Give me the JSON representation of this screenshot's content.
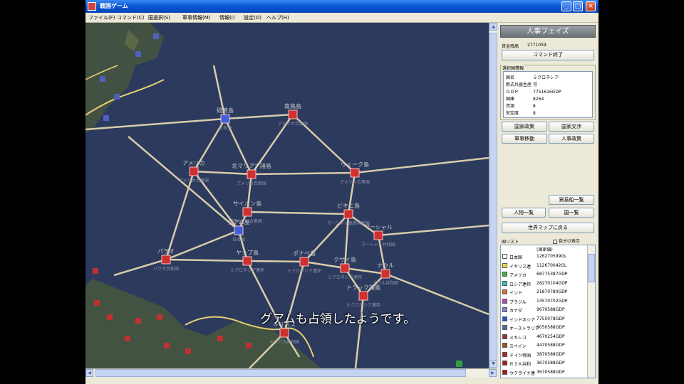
{
  "window": {
    "title": "戦国ゲーム"
  },
  "menu": [
    "ファイル(F)",
    "コマンド(C)",
    "国選択(S)",
    "軍事情報(M)",
    "情報(I)",
    "設定(O)",
    "ヘルプ(H)"
  ],
  "panel": {
    "phase": "人事フェイズ",
    "funds_label": "資金残高",
    "funds_value": "2771059",
    "end_command": "コマンド終了",
    "selected_country_label": "選択国情報",
    "info": [
      {
        "k": "国名",
        "v": "ミクロネシア"
      },
      {
        "k": "新式兵器生産",
        "v": "可"
      },
      {
        "k": "ＧＤＰ",
        "v": "7751616GDP"
      },
      {
        "k": "国庫",
        "v": "8264"
      },
      {
        "k": "資源",
        "v": "8"
      },
      {
        "k": "安定度",
        "v": "8"
      }
    ],
    "action_buttons": [
      "国家政策",
      "国家交渉",
      "軍事移動",
      "人事政策"
    ],
    "trade_list": "貿易船一覧",
    "person_list": "人物一覧",
    "country_button": "国一覧",
    "world_map_back": "世界マップに戻る",
    "country_list_label": "国リスト",
    "color_display": "色分け表示",
    "list_header": "(国家値)",
    "countries": [
      {
        "name": "日本国",
        "gdp": "126270599GL",
        "color": "#ffffff"
      },
      {
        "name": "イギリス連",
        "gdp": "112670042GL",
        "color": "#f0e040"
      },
      {
        "name": "アメリカ",
        "gdp": "68775387GDP",
        "color": "#30c030"
      },
      {
        "name": "ロシア連邦",
        "gdp": "28270104GDP",
        "color": "#30c0c0"
      },
      {
        "name": "インド",
        "gdp": "21870780GDP",
        "color": "#e07020"
      },
      {
        "name": "ブラジル",
        "gdp": "13570702GDP",
        "color": "#c040c0"
      },
      {
        "name": "カナダ",
        "gdp": "9670588GDP",
        "color": "#9080e0"
      },
      {
        "name": "インドネシア",
        "gdp": "7755078GDP",
        "color": "#3050d0"
      },
      {
        "name": "オーストラリア",
        "gdp": "6050588GDP",
        "color": "#507090"
      },
      {
        "name": "メキシコ",
        "gdp": "4670254GDP",
        "color": "#a03030"
      },
      {
        "name": "スペイン",
        "gdp": "4470588GDP",
        "color": "#a05010"
      },
      {
        "name": "ドイツ帝国",
        "gdp": "3870588GDP",
        "color": "#c02020"
      },
      {
        "name": "ＲＳＫ共和",
        "gdp": "3670588GDP",
        "color": "#b01818"
      },
      {
        "name": "ウクライナ連",
        "gdp": "3670588GDP",
        "color": "#c01010"
      }
    ]
  },
  "map": {
    "subtitle": "グアムも占領したようです。",
    "nodes": [
      {
        "name": "硫黄島",
        "sub": "日本領",
        "color": "#4060e0"
      },
      {
        "name": "南鳥島",
        "sub": "アメリカ合衆国",
        "color": "#d03030"
      },
      {
        "name": "アメリカ",
        "sub": "アメリカ合衆国",
        "color": "#d03030"
      },
      {
        "name": "北マリアナ諸島",
        "sub": "アメリカ合衆国",
        "color": "#d03030"
      },
      {
        "name": "ウェーク島",
        "sub": "アメリカ合衆国",
        "color": "#d03030"
      },
      {
        "name": "サイパン島",
        "sub": "アメリカ合衆国",
        "color": "#d03030"
      },
      {
        "name": "ビキニ島",
        "sub": "マーシャル諸島共和国",
        "color": "#d03030"
      },
      {
        "name": "グアム島",
        "sub": "日本国",
        "color": "#4060e0"
      },
      {
        "name": "マーシャル",
        "sub": "マーシャル共和国",
        "color": "#d03030"
      },
      {
        "name": "パラオ",
        "sub": "パラオ共和国",
        "color": "#d03030"
      },
      {
        "name": "ヤップ島",
        "sub": "ミクロネシア連邦",
        "color": "#d03030"
      },
      {
        "name": "ポナペ島",
        "sub": "ミクロネシア連邦",
        "color": "#d03030"
      },
      {
        "name": "クサイ島",
        "sub": "ミクロネシア連邦",
        "color": "#d03030"
      },
      {
        "name": "ナウル",
        "sub": "ナウル共和国",
        "color": "#d03030"
      },
      {
        "name": "トラック諸島",
        "sub": "ミクロネシア連邦",
        "color": "#d03030"
      },
      {
        "name": "キリバス",
        "sub": "キリバス共和国",
        "color": "#d03030"
      }
    ]
  }
}
